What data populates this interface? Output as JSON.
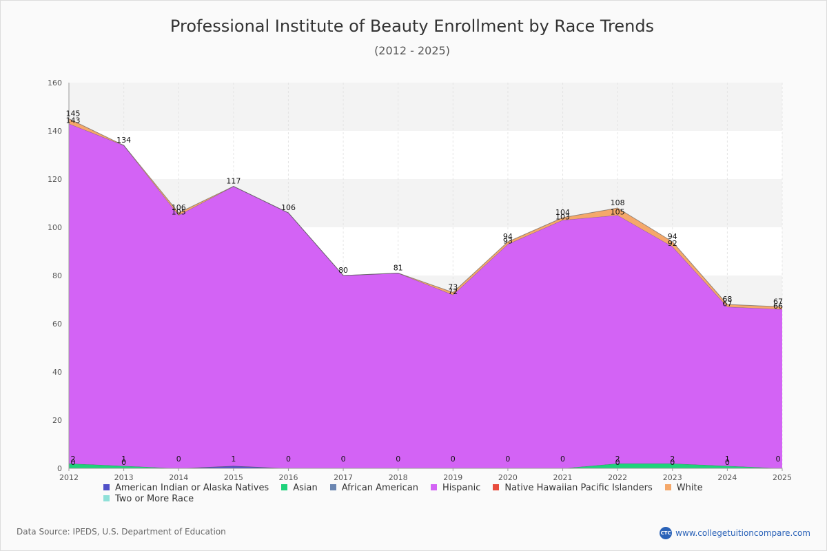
{
  "title": "Professional Institute of Beauty Enrollment by Race Trends",
  "subtitle": "(2012 - 2025)",
  "source": "Data Source: IPEDS, U.S. Department of Education",
  "brand": {
    "logo_text": "CTC",
    "url": "www.collegetuitioncompare.com"
  },
  "chart_data": {
    "type": "area",
    "stacked": true,
    "x": [
      2012,
      2013,
      2014,
      2015,
      2016,
      2017,
      2018,
      2019,
      2020,
      2021,
      2022,
      2023,
      2024,
      2025
    ],
    "ylim": [
      0,
      160
    ],
    "yticks": [
      0,
      20,
      40,
      60,
      80,
      100,
      120,
      140,
      160
    ],
    "grid": "horizontal alternating bands",
    "legend_position": "bottom",
    "series": [
      {
        "name": "American Indian or Alaska Natives",
        "color": "#5050c8",
        "values": [
          0,
          0,
          0,
          1,
          0,
          0,
          0,
          0,
          0,
          0,
          0,
          0,
          0,
          0
        ]
      },
      {
        "name": "Asian",
        "color": "#1ed27a",
        "values": [
          2,
          1,
          0,
          0,
          0,
          0,
          0,
          0,
          0,
          0,
          2,
          2,
          1,
          0
        ]
      },
      {
        "name": "African American",
        "color": "#6b86b2",
        "values": [
          0,
          0,
          0,
          0,
          0,
          0,
          0,
          0,
          0,
          0,
          0,
          0,
          0,
          0
        ]
      },
      {
        "name": "Hispanic",
        "color": "#d363f5",
        "values": [
          141,
          133,
          105,
          116,
          106,
          80,
          81,
          72,
          93,
          103,
          103,
          90,
          66,
          66
        ]
      },
      {
        "name": "Native Hawaiian Pacific Islanders",
        "color": "#e84c3d",
        "values": [
          0,
          0,
          0,
          0,
          0,
          0,
          0,
          0,
          0,
          0,
          0,
          0,
          0,
          0
        ]
      },
      {
        "name": "White",
        "color": "#f5a86a",
        "values": [
          2,
          0,
          1,
          0,
          0,
          0,
          0,
          1,
          1,
          1,
          3,
          2,
          1,
          1
        ]
      },
      {
        "name": "Two or More Race",
        "color": "#8fe0d8",
        "values": [
          0,
          0,
          0,
          0,
          0,
          0,
          0,
          0,
          0,
          0,
          0,
          0,
          0,
          0
        ]
      }
    ],
    "annotations": {
      "bottom": [
        "2",
        "1",
        "0",
        "1",
        "0",
        "0",
        "0",
        "0",
        "0",
        "0",
        "2",
        "2",
        "1",
        "0"
      ],
      "bottom_secondary": [
        "0",
        "0",
        "",
        "",
        "",
        "",
        "",
        "",
        "",
        "",
        "0",
        "0",
        "0",
        ""
      ],
      "top": [
        "145",
        "134",
        "106",
        "117",
        "106",
        "80",
        "81",
        "73",
        "94",
        "104",
        "108",
        "94",
        "68",
        "67"
      ],
      "top_secondary": [
        "143",
        "",
        "105",
        "",
        "",
        "",
        "",
        "72",
        "93",
        "103",
        "105",
        "92",
        "67",
        "66"
      ]
    }
  }
}
